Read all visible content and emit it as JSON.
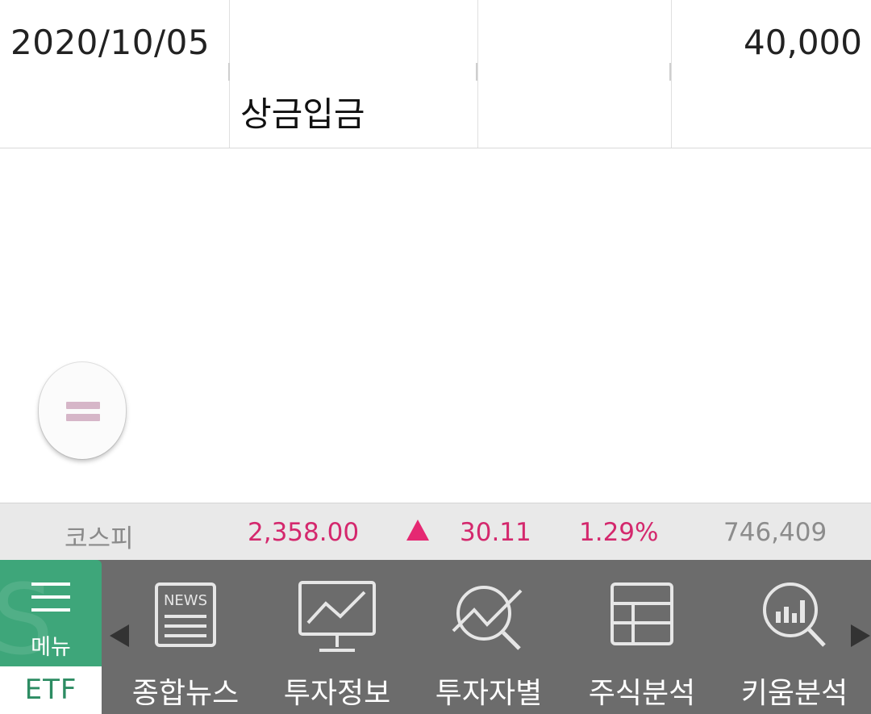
{
  "transaction": {
    "date": "2020/10/05",
    "memo": "상금입금",
    "amount": "40,000"
  },
  "ticker": {
    "index_name": "코스피",
    "price": "2,358.00",
    "direction": "up",
    "change": "30.11",
    "change_pct": "1.29%",
    "volume": "746,409",
    "up_color": "#e52872"
  },
  "nav": {
    "menu_label": "메뉴",
    "etf_label": "ETF",
    "items": [
      {
        "label": "종합뉴스",
        "icon": "news-icon"
      },
      {
        "label": "투자정보",
        "icon": "monitor-chart-icon"
      },
      {
        "label": "투자자별",
        "icon": "search-trend-icon"
      },
      {
        "label": "주식분석",
        "icon": "table-icon"
      },
      {
        "label": "키움분석",
        "icon": "magnifier-bars-icon"
      }
    ],
    "accent_color": "#3ea67a"
  }
}
